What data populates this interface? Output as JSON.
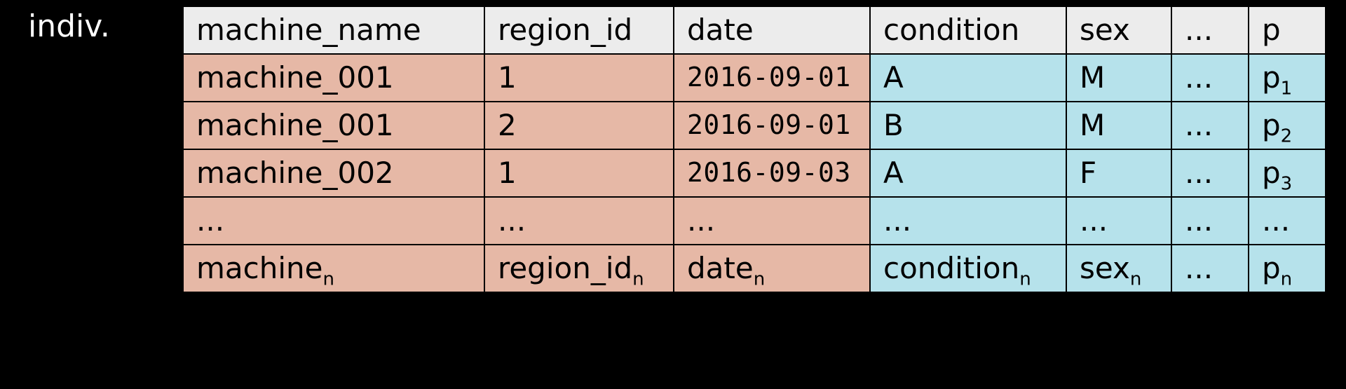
{
  "label_indiv": "indiv.",
  "headers": {
    "machine_name": "machine_name",
    "region_id": "region_id",
    "date": "date",
    "condition": "condition",
    "sex": "sex",
    "dots": "...",
    "p": "p"
  },
  "rows": {
    "r1": {
      "machine_name": "machine_001",
      "region_id": "1",
      "date": "2016-09-01",
      "condition": "A",
      "sex": "M",
      "dots": "...",
      "p_base": "p",
      "p_sub": "1"
    },
    "r2": {
      "machine_name": "machine_001",
      "region_id": "2",
      "date": "2016-09-01",
      "condition": "B",
      "sex": "M",
      "dots": "...",
      "p_base": "p",
      "p_sub": "2"
    },
    "r3": {
      "machine_name": "machine_002",
      "region_id": "1",
      "date": "2016-09-03",
      "condition": "A",
      "sex": "F",
      "dots": "...",
      "p_base": "p",
      "p_sub": "3"
    },
    "r4": {
      "machine_name": "...",
      "region_id": "...",
      "date": "...",
      "condition": "...",
      "sex": "...",
      "dots": "...",
      "p_text": "..."
    },
    "r5": {
      "machine_base": "machine",
      "machine_sub": "n",
      "region_base": "region_id",
      "region_sub": "n",
      "date_base": "date",
      "date_sub": "n",
      "condition_base": "condition",
      "condition_sub": "n",
      "sex_base": "sex",
      "sex_sub": "n",
      "dots": "...",
      "p_base": "p",
      "p_sub": "n"
    }
  }
}
